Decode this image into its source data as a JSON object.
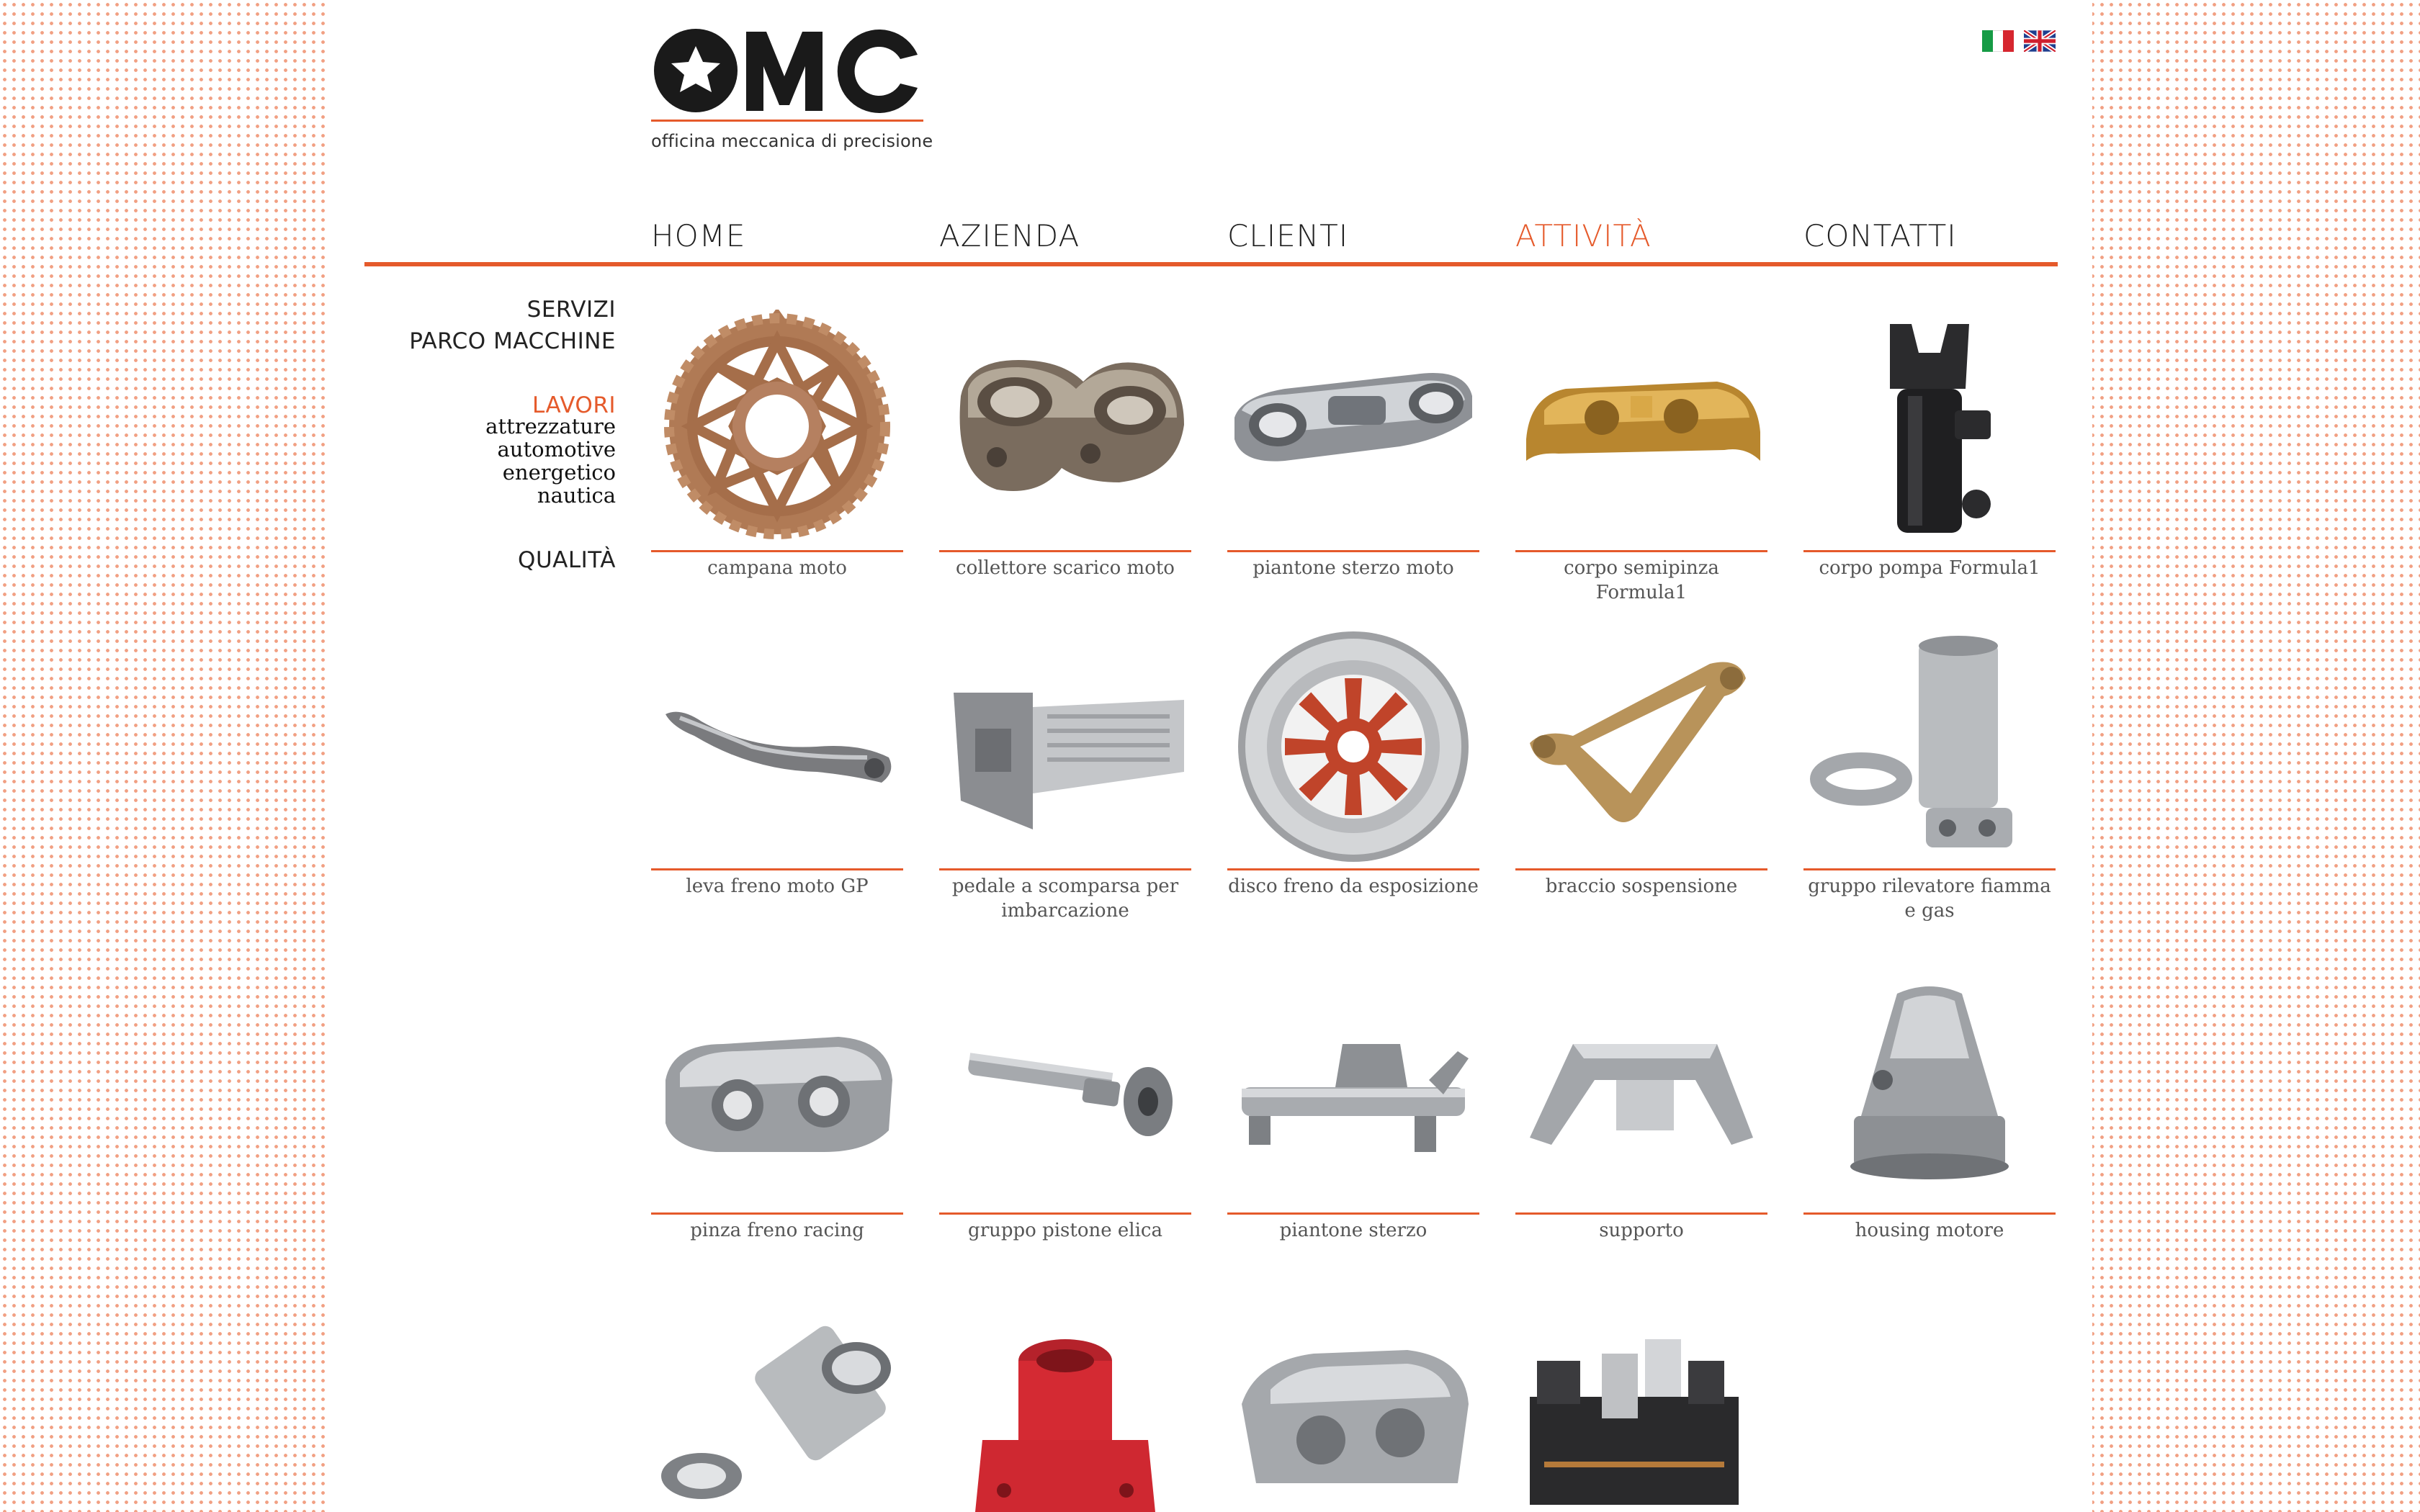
{
  "brand": {
    "logo_text": "OMC",
    "tagline": "officina meccanica di precisione",
    "accent_color": "#e55a2b"
  },
  "languages": [
    {
      "code": "it",
      "icon": "italian-flag-icon"
    },
    {
      "code": "en",
      "icon": "uk-flag-icon"
    }
  ],
  "nav": {
    "items": [
      {
        "label": "HOME"
      },
      {
        "label": "AZIENDA"
      },
      {
        "label": "CLIENTI"
      },
      {
        "label": "ATTIVITÀ",
        "active": true
      },
      {
        "label": "CONTATTI"
      }
    ]
  },
  "sidebar": {
    "servizi": "SERVIZI",
    "parco": "PARCO MACCHINE",
    "lavori": "LAVORI",
    "lavori_sub": [
      "attrezzature",
      "automotive",
      "energetico",
      "nautica"
    ],
    "qualita": "QUALITÀ"
  },
  "products": [
    {
      "caption": "campana moto",
      "icon": "sprocket-image"
    },
    {
      "caption": "collettore scarico moto",
      "icon": "exhaust-manifold-image"
    },
    {
      "caption": "piantone sterzo moto",
      "icon": "steering-yoke-image"
    },
    {
      "caption": "corpo semipinza Formula1",
      "icon": "brake-caliper-gold-image"
    },
    {
      "caption": "corpo pompa Formula1",
      "icon": "pump-body-image"
    },
    {
      "caption": "leva freno moto GP",
      "icon": "brake-lever-image"
    },
    {
      "caption": "pedale a scomparsa per imbarcazione",
      "icon": "boat-pedal-image"
    },
    {
      "caption": "disco freno da esposizione",
      "icon": "brake-disc-image"
    },
    {
      "caption": "braccio sospensione",
      "icon": "suspension-arm-image"
    },
    {
      "caption": "gruppo rilevatore fiamma e gas",
      "icon": "flame-detector-image"
    },
    {
      "caption": "pinza freno racing",
      "icon": "racing-caliper-image"
    },
    {
      "caption": "gruppo pistone elica",
      "icon": "propeller-piston-image"
    },
    {
      "caption": "piantone sterzo",
      "icon": "steering-column-image"
    },
    {
      "caption": "supporto",
      "icon": "support-bracket-image"
    },
    {
      "caption": "housing motore",
      "icon": "motor-housing-image"
    },
    {
      "caption": "",
      "icon": "cylinder-parts-image"
    },
    {
      "caption": "",
      "icon": "red-housing-image"
    },
    {
      "caption": "",
      "icon": "aluminum-caliper-image"
    },
    {
      "caption": "",
      "icon": "fixture-assembly-image"
    }
  ]
}
